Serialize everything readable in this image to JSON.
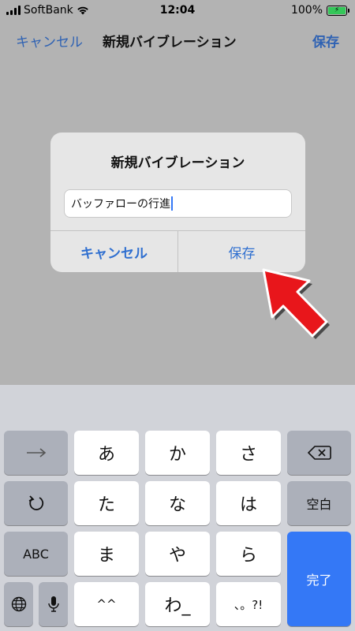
{
  "status": {
    "carrier": "SoftBank",
    "time": "12:04",
    "battery": "100%"
  },
  "nav": {
    "cancel": "キャンセル",
    "title": "新規バイブレーション",
    "save": "保存"
  },
  "dialog": {
    "title": "新規バイブレーション",
    "input_value": "バッファローの行進",
    "cancel": "キャンセル",
    "save": "保存"
  },
  "keyboard": {
    "row1": [
      "あ",
      "か",
      "さ"
    ],
    "row2": [
      "た",
      "な",
      "は"
    ],
    "row3": [
      "ま",
      "や",
      "ら"
    ],
    "row4": [
      "^^",
      "わ_",
      "、。?!"
    ],
    "space": "空白",
    "abc": "ABC",
    "done": "完了",
    "accent": "#3478f6"
  }
}
